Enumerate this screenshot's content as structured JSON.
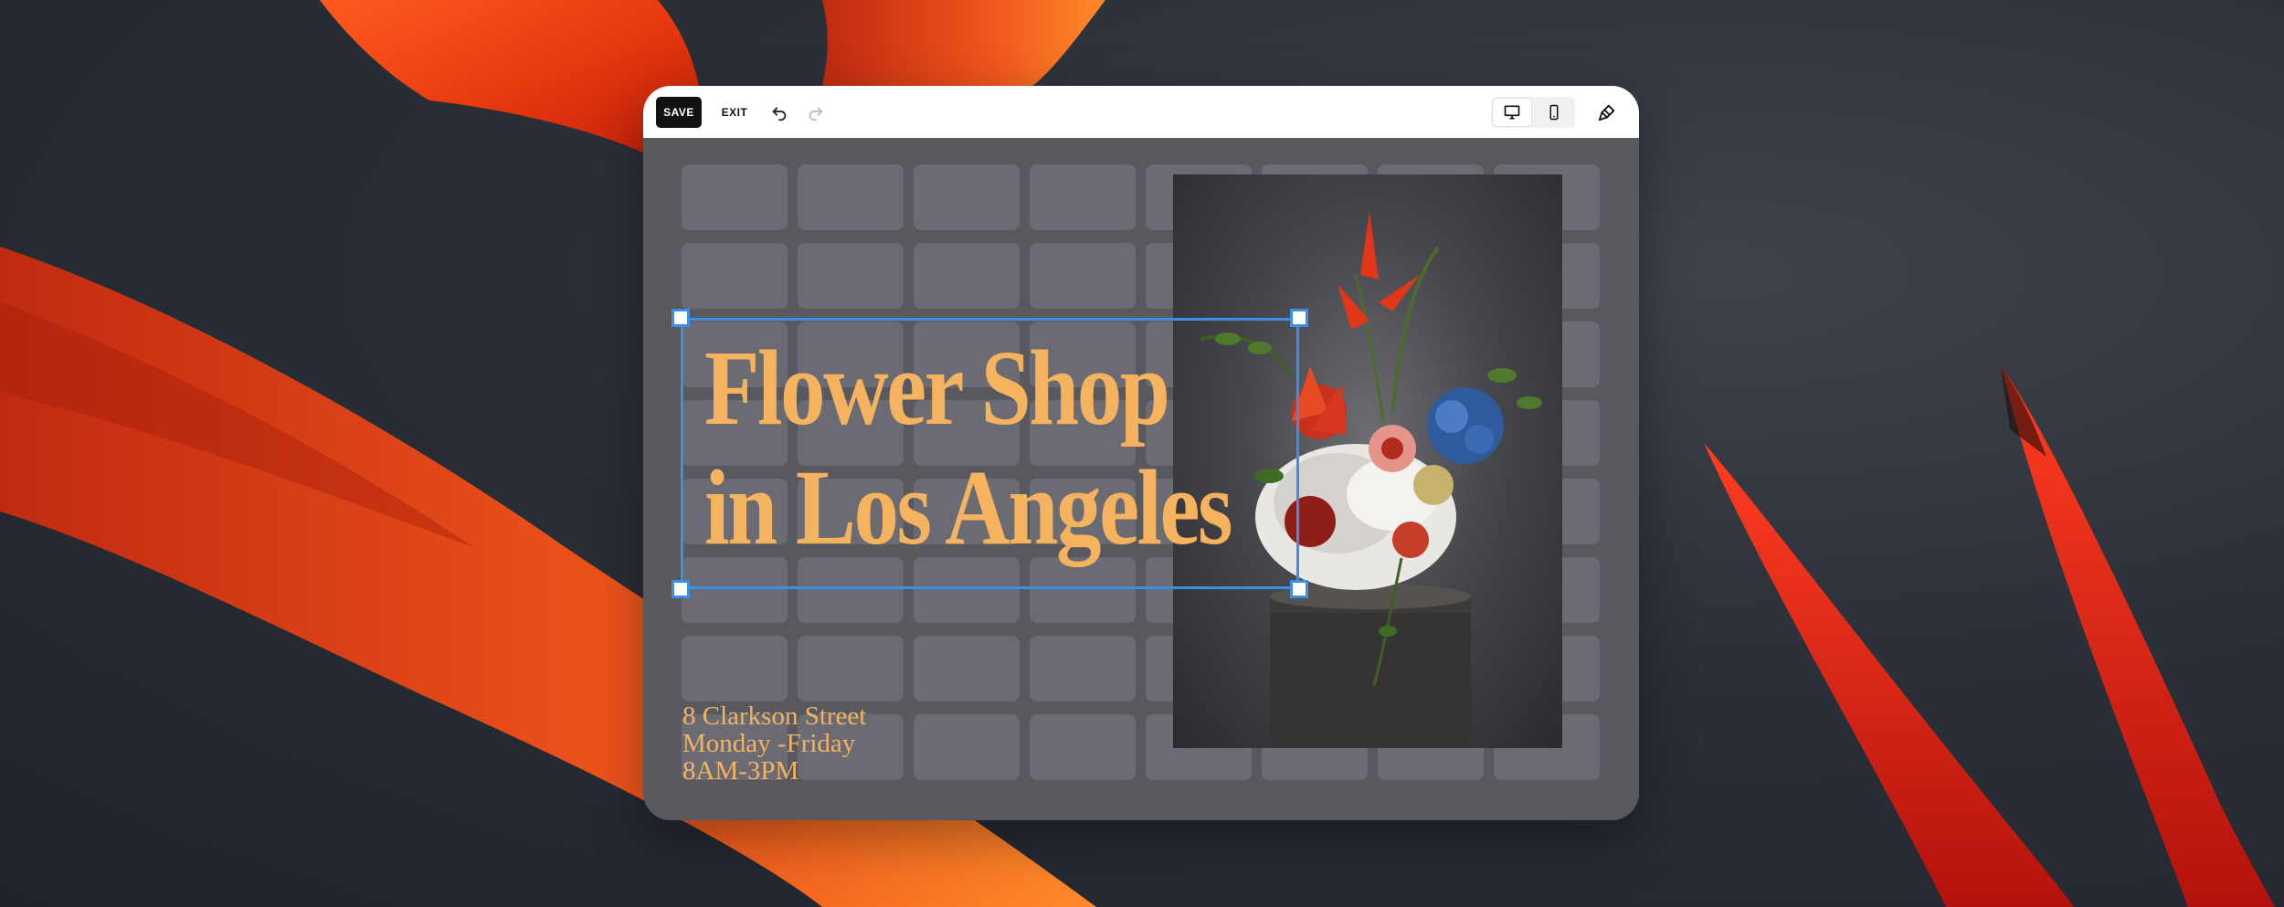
{
  "toolbar": {
    "save_label": "SAVE",
    "exit_label": "EXIT",
    "icons": [
      "undo-icon",
      "redo-icon",
      "desktop-icon",
      "mobile-icon",
      "paintbrush-icon"
    ],
    "active_view": "desktop"
  },
  "section": {
    "headline_line1": "Flower Shop",
    "headline_line2": "in Los Angeles",
    "address": "8 Clarkson Street",
    "days": "Monday -Friday",
    "hours": "8AM-3PM"
  },
  "colors": {
    "accent_text": "#f5b25f",
    "selection": "#3d8fe6",
    "save_button": "#111111",
    "grid_cell": "#6a6b73",
    "editor_bg": "#58595f"
  }
}
